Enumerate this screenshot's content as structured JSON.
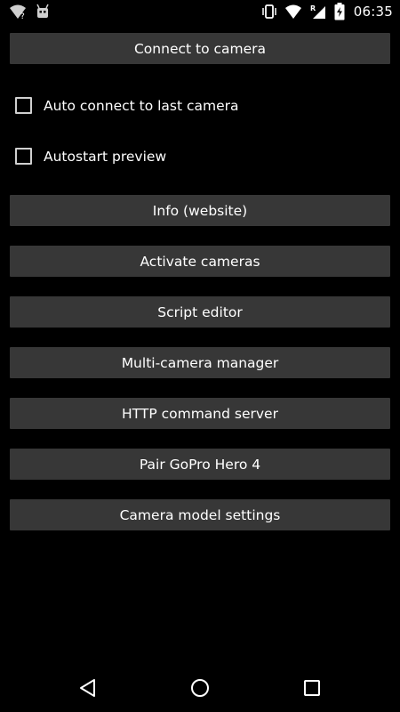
{
  "status_bar": {
    "time": "06:35",
    "left_icons": [
      "wifi-question-icon",
      "android-icon"
    ],
    "right_icons": [
      "vibrate-icon",
      "wifi-icon",
      "signal-roaming-icon",
      "battery-charging-icon"
    ]
  },
  "main": {
    "connect_label": "Connect to camera",
    "auto_connect_label": "Auto connect to last camera",
    "autostart_preview_label": "Autostart preview",
    "buttons": [
      "Info (website)",
      "Activate cameras",
      "Script editor",
      "Multi-camera manager",
      "HTTP command server",
      "Pair GoPro Hero 4",
      "Camera model settings"
    ]
  },
  "nav_bar": {
    "icons": [
      "back-icon",
      "home-icon",
      "recents-icon"
    ]
  },
  "colors": {
    "background": "#000000",
    "button": "#373737",
    "text": "#ffffff"
  }
}
